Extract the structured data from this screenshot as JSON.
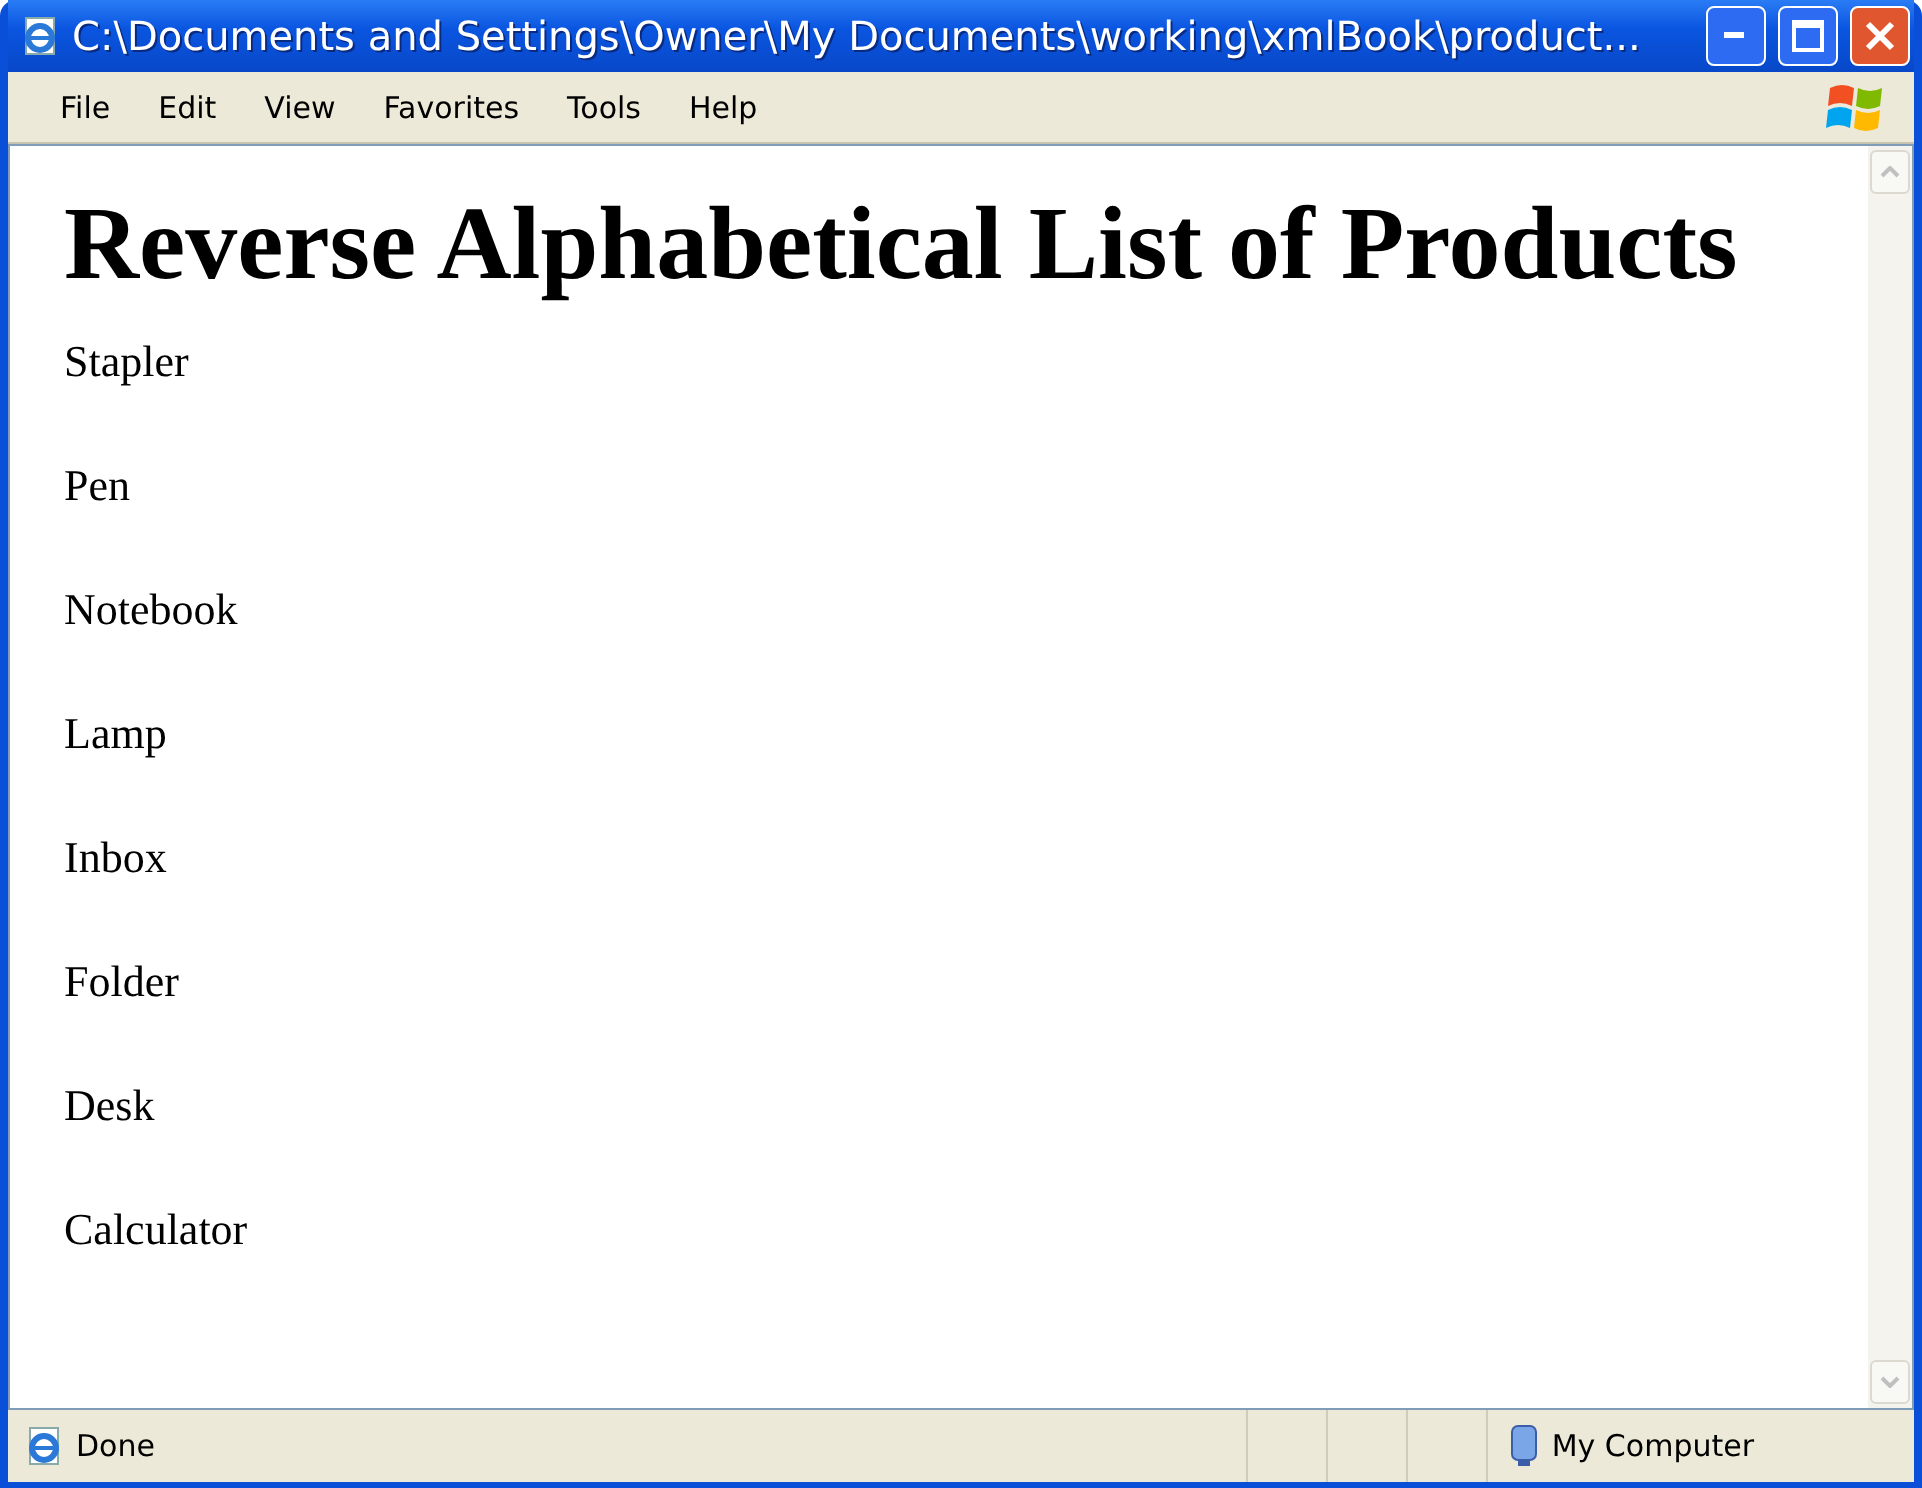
{
  "window": {
    "title": "C:\\Documents and Settings\\Owner\\My Documents\\working\\xmlBook\\product..."
  },
  "menu": [
    "File",
    "Edit",
    "View",
    "Favorites",
    "Tools",
    "Help"
  ],
  "page": {
    "heading": "Reverse Alphabetical List of Products",
    "items": [
      "Stapler",
      "Pen",
      "Notebook",
      "Lamp",
      "Inbox",
      "Folder",
      "Desk",
      "Calculator"
    ]
  },
  "status_bar": {
    "status": "Done",
    "zone": "My Computer"
  }
}
